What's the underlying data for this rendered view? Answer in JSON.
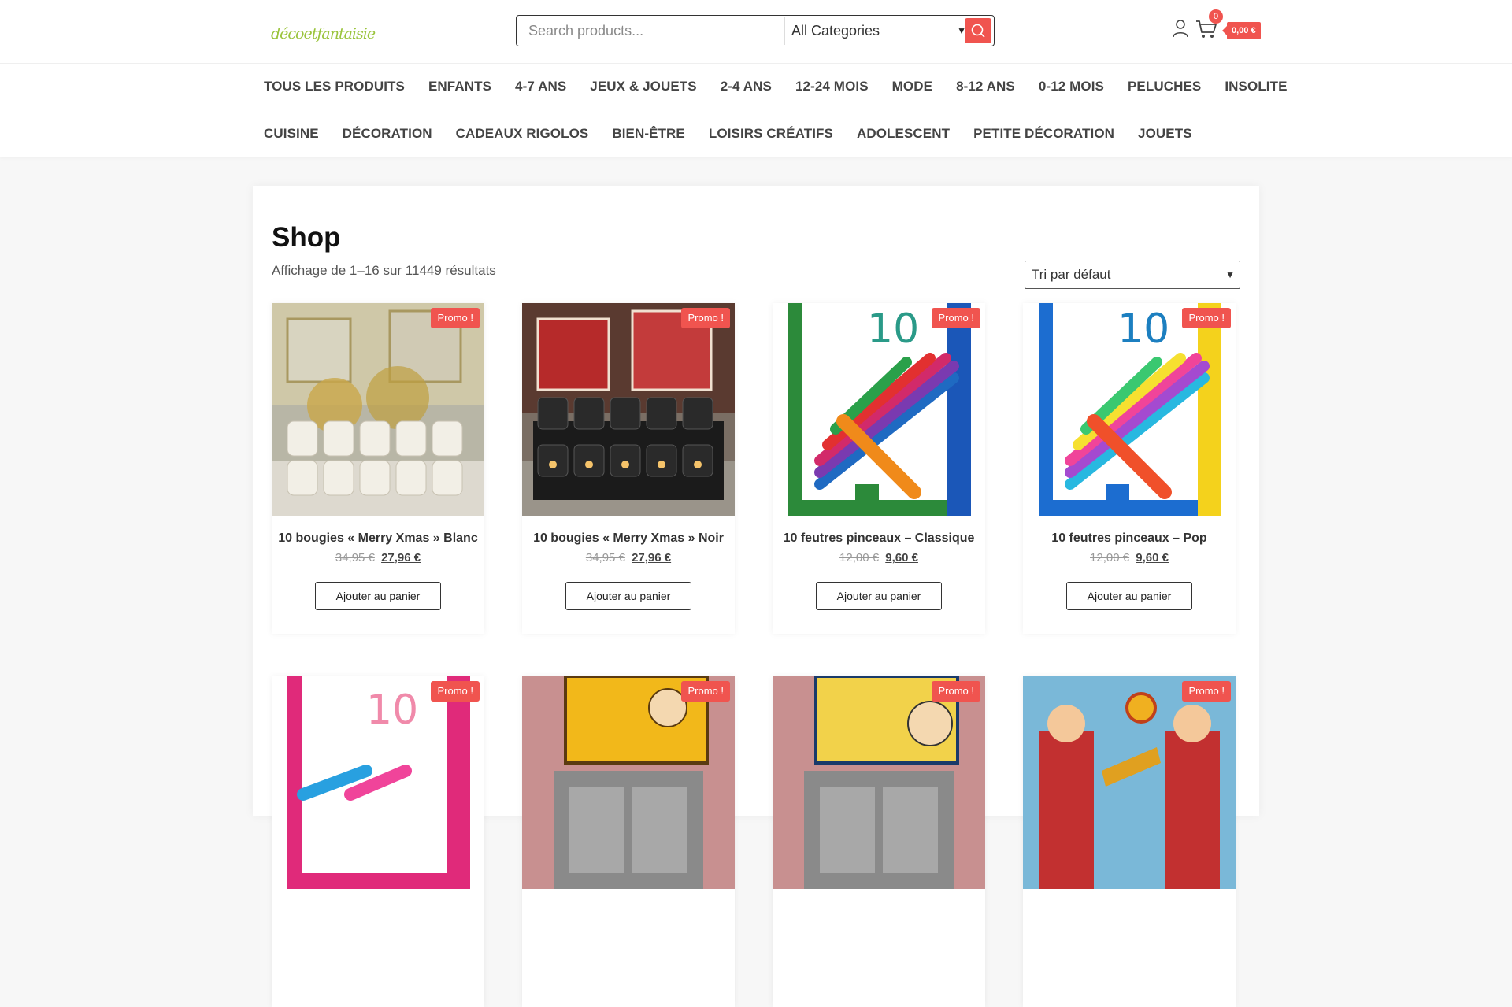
{
  "header": {
    "logo_text": "décoetfantaisie",
    "search": {
      "placeholder": "Search products...",
      "category": "All Categories"
    },
    "cart": {
      "count": "0",
      "total": "0,00 €"
    }
  },
  "nav": {
    "row1": [
      "TOUS LES PRODUITS",
      "ENFANTS",
      "4-7 ANS",
      "JEUX & JOUETS",
      "2-4 ANS",
      "12-24 MOIS",
      "MODE",
      "8-12 ANS",
      "0-12 MOIS",
      "PELUCHES",
      "INSOLITE"
    ],
    "row2": [
      "CUISINE",
      "DÉCORATION",
      "CADEAUX RIGOLOS",
      "BIEN-ÊTRE",
      "LOISIRS CRÉATIFS",
      "ADOLESCENT",
      "PETITE DÉCORATION",
      "JOUETS"
    ]
  },
  "shop": {
    "title": "Shop",
    "result_count": "Affichage de 1–16 sur 11449 résultats",
    "sort": "Tri par défaut"
  },
  "products": [
    {
      "name": "10 bougies « Merry Xmas » Blanc",
      "old_price": "34,95 €",
      "price": "27,96 €",
      "badge": "Promo !",
      "button": "Ajouter au panier",
      "image": "white-candles"
    },
    {
      "name": "10 bougies « Merry Xmas » Noir",
      "old_price": "34,95 €",
      "price": "27,96 €",
      "badge": "Promo !",
      "button": "Ajouter au panier",
      "image": "black-candles"
    },
    {
      "name": "10 feutres pinceaux – Classique",
      "old_price": "12,00 €",
      "price": "9,60 €",
      "badge": "Promo !",
      "button": "Ajouter au panier",
      "image": "brush-pens-classic"
    },
    {
      "name": "10 feutres pinceaux – Pop",
      "old_price": "12,00 €",
      "price": "9,60 €",
      "badge": "Promo !",
      "button": "Ajouter au panier",
      "image": "brush-pens-pop"
    },
    {
      "badge": "Promo !",
      "image": "brush-pens-pink"
    },
    {
      "badge": "Promo !",
      "image": "100-blagues-pourquoi"
    },
    {
      "badge": "Promo !",
      "image": "100-couples-celebres"
    },
    {
      "badge": "Promo !",
      "image": "marching-band-game"
    }
  ],
  "colors": {
    "accent": "#f0544f"
  }
}
